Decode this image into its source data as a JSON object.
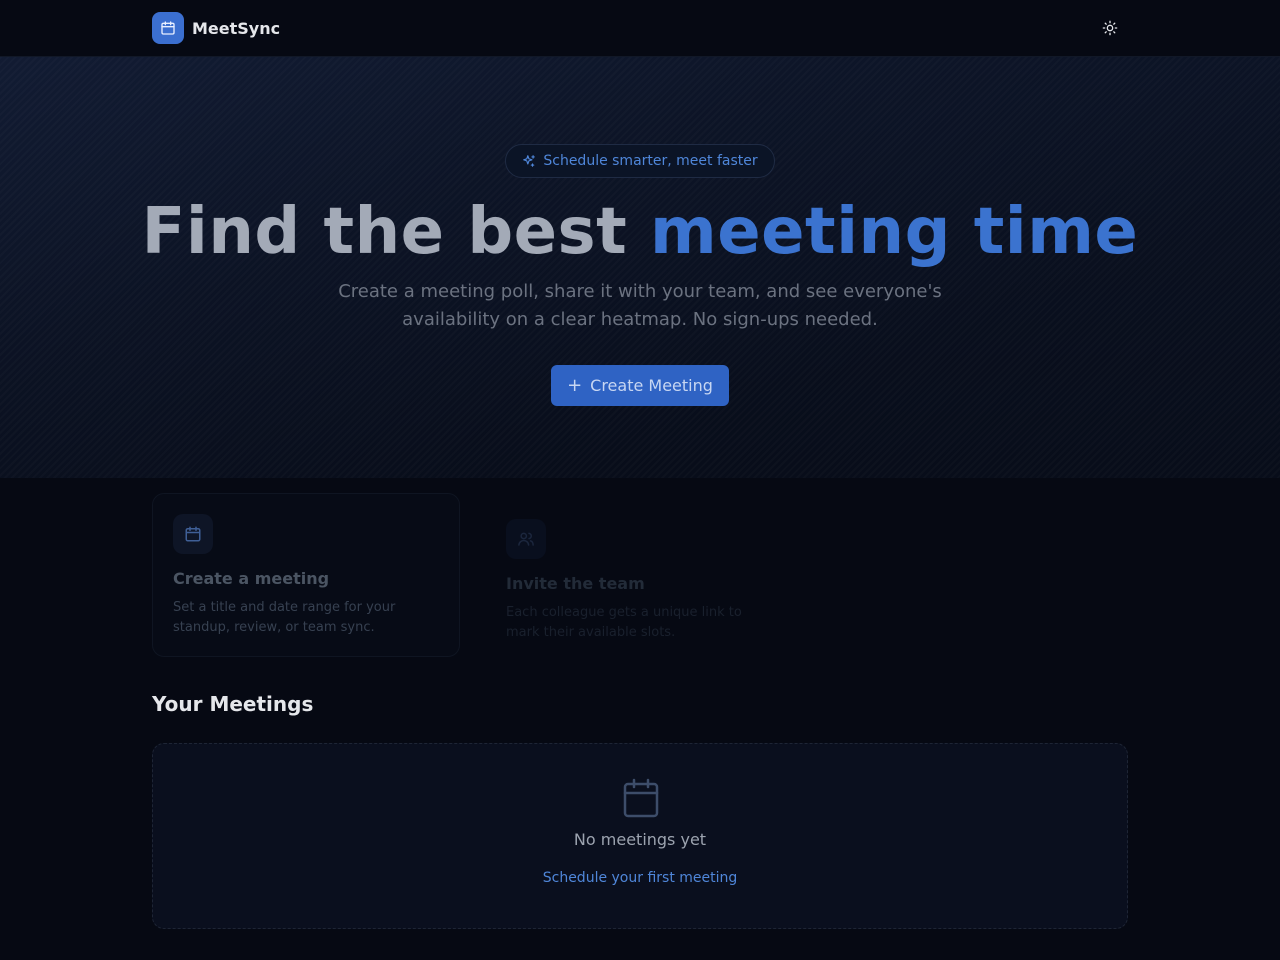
{
  "app": {
    "name": "MeetSync"
  },
  "header": {
    "logo_icon": "calendar-icon",
    "theme_icon": "sun-icon"
  },
  "hero": {
    "badge": "Schedule smarter, meet faster",
    "badge_icon": "sparkles-icon",
    "headline_plain": "Find the best",
    "headline_accent": "meeting time",
    "subtitle": "Create a meeting poll, share it with your team, and see everyone's availability on a clear heatmap. No sign-ups needed.",
    "cta_icon": "+",
    "cta_label": "Create Meeting"
  },
  "steps": [
    {
      "icon": "calendar-icon",
      "title": "Create a meeting",
      "description": "Set a title and date range for your standup, review, or team sync."
    },
    {
      "icon": "users-icon",
      "title": "Invite the team",
      "description": "Each colleague gets a unique link to mark their available slots."
    }
  ],
  "meetings": {
    "title": "Your Meetings",
    "empty_icon": "calendar-icon",
    "empty_text": "No meetings yet",
    "empty_link": "Schedule your first meeting"
  },
  "colors": {
    "accent": "#3b73cf",
    "background": "#060913",
    "button": "#2f63c4"
  }
}
